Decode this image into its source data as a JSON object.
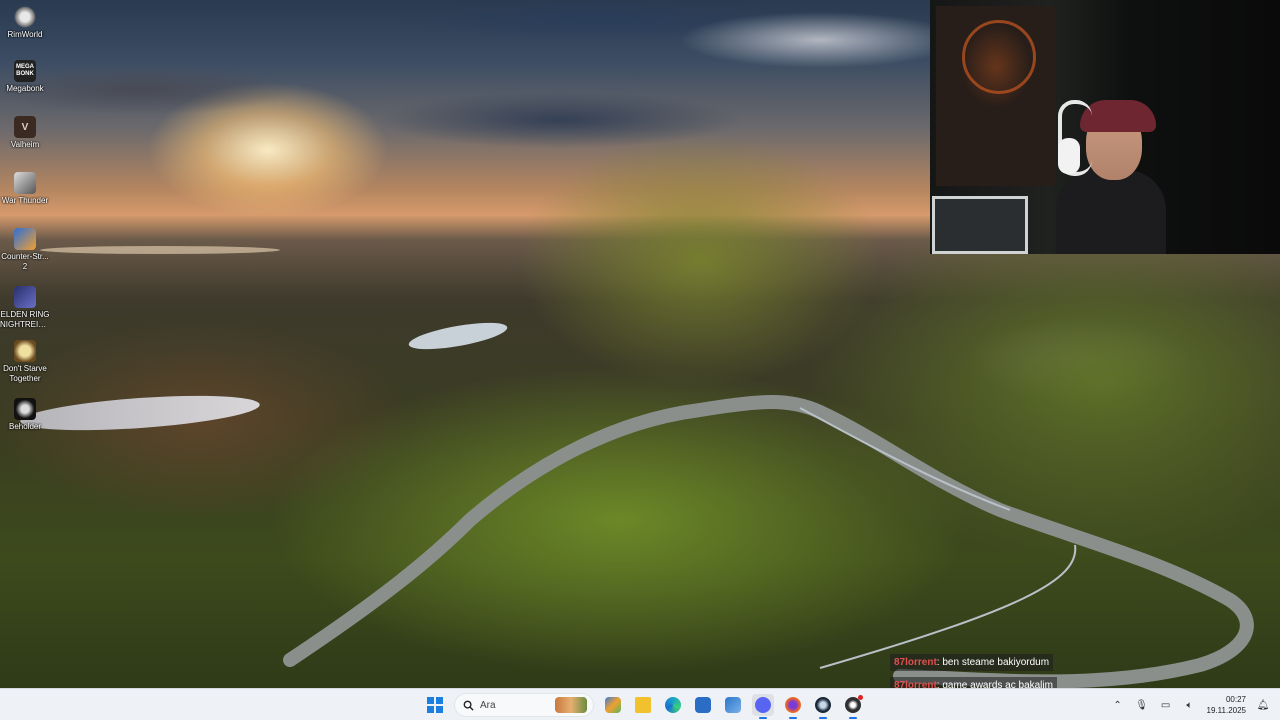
{
  "desktop_icons": [
    {
      "label": "RimWorld",
      "icon": "rimworld-icon"
    },
    {
      "label": "Megabonk",
      "icon": "megabonk-icon",
      "icon_text": "MEGA BONK"
    },
    {
      "label": "Valheim",
      "icon": "valheim-icon",
      "icon_text": "V"
    },
    {
      "label": "War Thunder",
      "icon": "war-thunder-icon"
    },
    {
      "label": "Counter-Str... 2",
      "icon": "counter-strike-2-icon"
    },
    {
      "label": "ELDEN RING NIGHTREIGN",
      "icon": "elden-ring-nightreign-icon"
    },
    {
      "label": "Don't Starve Together",
      "icon": "dont-starve-together-icon"
    },
    {
      "label": "Beholder",
      "icon": "beholder-icon"
    }
  ],
  "chat": [
    {
      "user": "87lorrent",
      "message": ": ben steame bakiyordum"
    },
    {
      "user": "87lorrent",
      "message": ": game awards ac bakalim"
    }
  ],
  "taskbar": {
    "search_placeholder": "Ara",
    "apps": [
      {
        "name": "task-view-icon",
        "color": "#3a7bd5"
      },
      {
        "name": "file-explorer-icon",
        "color": "#f2c12e"
      },
      {
        "name": "edge-icon",
        "color": "#1aa3c8"
      },
      {
        "name": "microsoft-store-icon",
        "color": "#2b6cc4"
      },
      {
        "name": "outlook-icon",
        "color": "#2a77c9"
      },
      {
        "name": "discord-icon",
        "color": "#5865f2"
      },
      {
        "name": "firefox-icon",
        "color": "#e8642c"
      },
      {
        "name": "steam-icon",
        "color": "#1b2838"
      },
      {
        "name": "obs-icon",
        "color": "#303030"
      }
    ],
    "clock_time": "00:27",
    "clock_date": "19.11.2025"
  },
  "colors": {
    "taskbar_bg": "#eef1f6",
    "accent": "#1a7fe0",
    "chat_username": "#e05050"
  }
}
